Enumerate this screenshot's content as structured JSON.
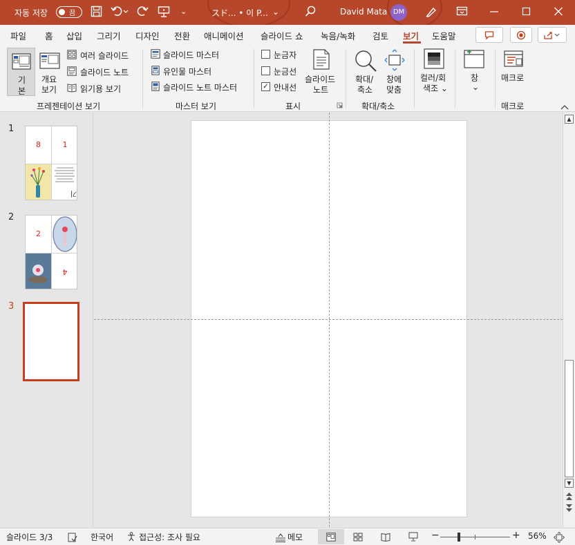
{
  "titlebar": {
    "autosave_label": "자동 저장",
    "autosave_state": "끔",
    "doc_title": "スド...  • 이 P...",
    "user_name": "David Mata",
    "user_initials": "DM"
  },
  "tabs": [
    "파일",
    "홈",
    "삽입",
    "그리기",
    "디자인",
    "전환",
    "애니메이션",
    "슬라이드 쇼",
    "녹음/녹화",
    "검토",
    "보기",
    "도움말"
  ],
  "active_tab": "보기",
  "ribbon": {
    "presentation_views": {
      "normal": "기\n본",
      "normal_l1": "기",
      "normal_l2": "본",
      "outline_l1": "개요",
      "outline_l2": "보기",
      "slide_sorter": "여러 슬라이드",
      "notes_page": "슬라이드 노트",
      "reading_view": "읽기용 보기",
      "group": "프레젠테이션 보기"
    },
    "master_views": {
      "slide_master": "슬라이드 마스터",
      "handout_master": "유인물 마스터",
      "notes_master": "슬라이드 노트 마스터",
      "group": "마스터 보기"
    },
    "show": {
      "ruler": "눈금자",
      "gridlines": "눈금선",
      "guides": "안내선",
      "ruler_checked": false,
      "gridlines_checked": false,
      "guides_checked": true,
      "notes_l1": "슬라이드",
      "notes_l2": "노트",
      "group": "표시"
    },
    "zoom": {
      "zoom_l1": "확대/",
      "zoom_l2": "축소",
      "fit_l1": "창에",
      "fit_l2": "맞춤",
      "group": "확대/축소"
    },
    "color": {
      "l1": "컬러/회",
      "l2": "색조 ⌄"
    },
    "window": {
      "l1": "창",
      "l2": "⌄"
    },
    "macros": {
      "label": "매크로",
      "group": "매크로"
    }
  },
  "slides": [
    {
      "num": "1",
      "q1": "8",
      "q2": "1",
      "q4": "0|ㄴ는기"
    },
    {
      "num": "2",
      "q1": "2",
      "q4": "4"
    },
    {
      "num": "3"
    }
  ],
  "selected_slide": "3",
  "status": {
    "slide_info": "슬라이드 3/3",
    "language": "한국어",
    "accessibility": "접근성: 조사 필요",
    "notes": "메모",
    "zoom": "56%"
  },
  "colors": {
    "accent": "#b7472a",
    "selection": "#c43e1c"
  }
}
